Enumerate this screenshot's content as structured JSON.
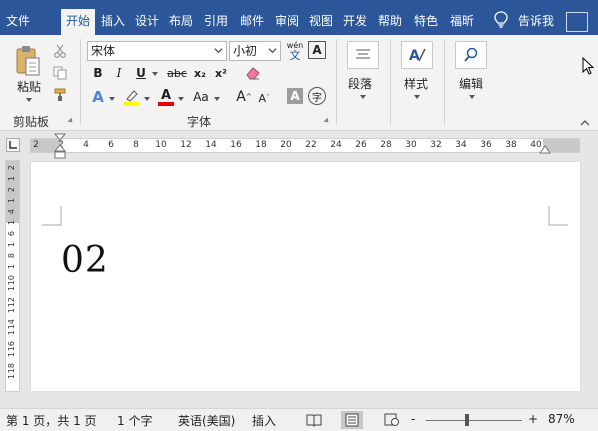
{
  "tabs": [
    {
      "label": "文件",
      "active": false
    },
    {
      "label": "开始",
      "active": true
    },
    {
      "label": "插入",
      "active": false
    },
    {
      "label": "设计",
      "active": false
    },
    {
      "label": "布局",
      "active": false
    },
    {
      "label": "引用",
      "active": false
    },
    {
      "label": "邮件",
      "active": false
    },
    {
      "label": "审阅",
      "active": false
    },
    {
      "label": "视图",
      "active": false
    },
    {
      "label": "开发",
      "active": false
    },
    {
      "label": "帮助",
      "active": false
    },
    {
      "label": "特色",
      "active": false
    },
    {
      "label": "福昕",
      "active": false
    }
  ],
  "tell_me": "告诉我",
  "clipboard": {
    "paste_label": "粘贴",
    "group_label": "剪贴板"
  },
  "font": {
    "family": "宋体",
    "size": "小初",
    "phonetic": "wén",
    "group_label": "字体",
    "bold": "B",
    "italic": "I",
    "underline": "U",
    "strike": "abc",
    "subscript": "x₂",
    "superscript": "x²",
    "grow": "A",
    "shrink": "A",
    "aa": "Aa",
    "char_border": "A",
    "char_shading": "A",
    "enclose": "字",
    "font_color": "A",
    "text_effects": "A",
    "highlight_color": "#ffff00",
    "font_color_value": "#e00000"
  },
  "paragraph": {
    "label": "段落"
  },
  "styles": {
    "label": "样式"
  },
  "editing": {
    "label": "编辑"
  },
  "ruler": {
    "h_ticks": [
      "2",
      "2",
      "4",
      "6",
      "8",
      "10",
      "12",
      "14",
      "16",
      "18",
      "20",
      "22",
      "24",
      "26",
      "28",
      "30",
      "32",
      "34",
      "36",
      "38",
      "40"
    ],
    "v_ticks": [
      "2",
      "1",
      "2",
      "1",
      "4",
      "1",
      "6",
      "1",
      "8",
      "1",
      "10",
      "1",
      "12",
      "1",
      "14",
      "1",
      "16",
      "1",
      "18",
      "1",
      "20"
    ]
  },
  "document": {
    "text": "02"
  },
  "status": {
    "page": "第 1 页，共 1 页",
    "words": "1 个字",
    "language": "英语(美国)",
    "mode": "插入",
    "zoom_value": 0.87,
    "zoom_label": "87%",
    "minus": "-",
    "plus": "+"
  },
  "colors": {
    "brand": "#2b579a",
    "ribbon": "#f3f3f3",
    "workspace": "#e6e6e6"
  }
}
